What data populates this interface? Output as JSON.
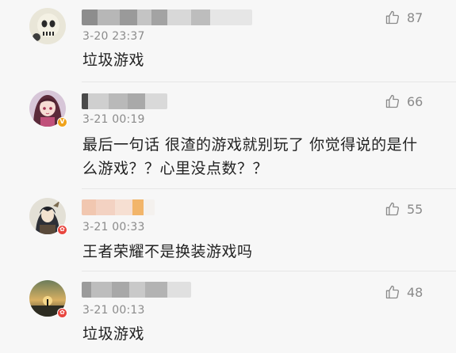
{
  "comments": [
    {
      "time": "3-20 23:37",
      "text": "垃圾游戏",
      "likes": "87",
      "badge": "",
      "avatar_icon": "skull-avatar-icon"
    },
    {
      "time": "3-21 00:19",
      "text": "最后一句话 很渣的游戏就别玩了 你觉得说的是什么游戏？？心里没点数？？",
      "likes": "66",
      "badge": "V",
      "avatar_icon": "anime-girl-avatar-icon"
    },
    {
      "time": "3-21 00:33",
      "text": "王者荣耀不是换装游戏吗",
      "likes": "55",
      "badge": "✿",
      "avatar_icon": "anime-boy-avatar-icon"
    },
    {
      "time": "3-21 00:13",
      "text": "垃圾游戏",
      "likes": "48",
      "badge": "✿",
      "avatar_icon": "sunset-avatar-icon"
    }
  ],
  "colors": {
    "background": "#f7f7f7",
    "time_text": "#8b8b8b",
    "body_text": "#222222",
    "like_icon": "#8a8a8a",
    "vip_badge": "#f0a31b",
    "fan_badge": "#e8463f"
  },
  "icons": {
    "like": "thumbs-up-icon"
  }
}
